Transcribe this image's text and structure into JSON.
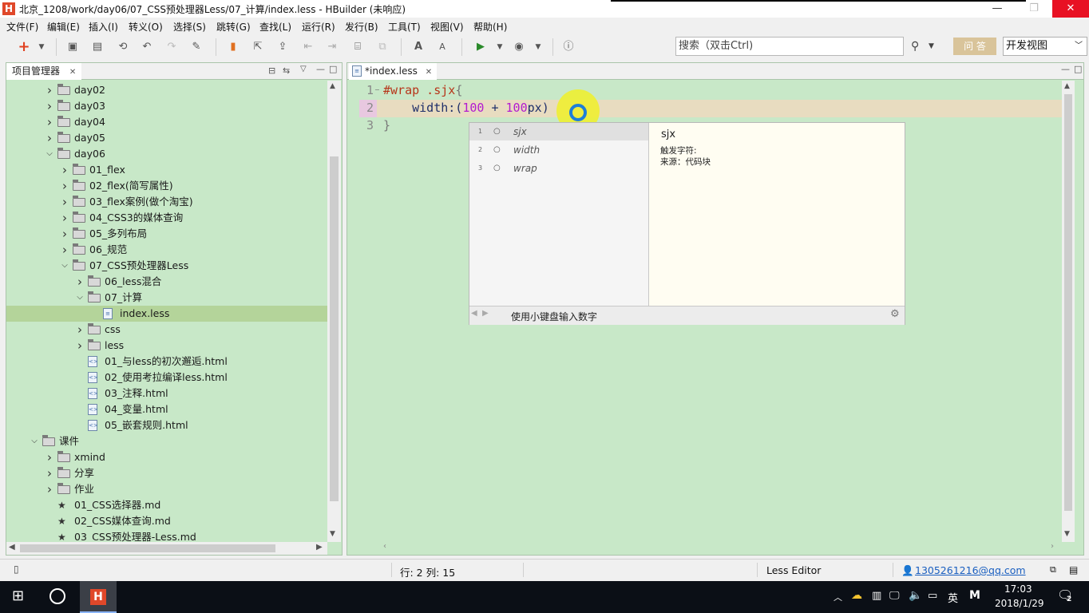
{
  "window": {
    "title": "北京_1208/work/day06/07_CSS预处理器Less/07_计算/index.less - HBuilder  (未响应)",
    "logo": "H",
    "minimize": "—",
    "maximize": "❐",
    "close": "✕"
  },
  "menu": [
    "文件(F)",
    "编辑(E)",
    "插入(I)",
    "转义(O)",
    "选择(S)",
    "跳转(G)",
    "查找(L)",
    "运行(R)",
    "发行(B)",
    "工具(T)",
    "视图(V)",
    "帮助(H)"
  ],
  "toolbar": {
    "search_placeholder": "搜索（双击Ctrl)",
    "ask_label": "问 答",
    "view_select": "开发视图"
  },
  "project_panel": {
    "tab_label": "项目管理器",
    "tree": [
      {
        "label": "day02",
        "type": "folder",
        "depth": 2,
        "state": "collapsed"
      },
      {
        "label": "day03",
        "type": "folder",
        "depth": 2,
        "state": "collapsed"
      },
      {
        "label": "day04",
        "type": "folder",
        "depth": 2,
        "state": "collapsed"
      },
      {
        "label": "day05",
        "type": "folder",
        "depth": 2,
        "state": "collapsed"
      },
      {
        "label": "day06",
        "type": "folder",
        "depth": 2,
        "state": "expanded"
      },
      {
        "label": "01_flex",
        "type": "folder",
        "depth": 3,
        "state": "collapsed"
      },
      {
        "label": "02_flex(简写属性)",
        "type": "folder",
        "depth": 3,
        "state": "collapsed"
      },
      {
        "label": "03_flex案例(做个淘宝)",
        "type": "folder",
        "depth": 3,
        "state": "collapsed"
      },
      {
        "label": "04_CSS3的媒体查询",
        "type": "folder",
        "depth": 3,
        "state": "collapsed"
      },
      {
        "label": "05_多列布局",
        "type": "folder",
        "depth": 3,
        "state": "collapsed"
      },
      {
        "label": "06_规范",
        "type": "folder",
        "depth": 3,
        "state": "collapsed"
      },
      {
        "label": "07_CSS预处理器Less",
        "type": "folder",
        "depth": 3,
        "state": "expanded"
      },
      {
        "label": "06_less混合",
        "type": "folder",
        "depth": 4,
        "state": "collapsed"
      },
      {
        "label": "07_计算",
        "type": "folder",
        "depth": 4,
        "state": "expanded"
      },
      {
        "label": "index.less",
        "type": "less",
        "depth": 5,
        "state": "selected"
      },
      {
        "label": "css",
        "type": "folder",
        "depth": 4,
        "state": "collapsed"
      },
      {
        "label": "less",
        "type": "folder",
        "depth": 4,
        "state": "collapsed"
      },
      {
        "label": "01_与less的初次邂逅.html",
        "type": "html",
        "depth": 4,
        "state": "leaf"
      },
      {
        "label": "02_使用考拉编译less.html",
        "type": "html",
        "depth": 4,
        "state": "leaf"
      },
      {
        "label": "03_注释.html",
        "type": "html",
        "depth": 4,
        "state": "leaf"
      },
      {
        "label": "04_变量.html",
        "type": "html",
        "depth": 4,
        "state": "leaf"
      },
      {
        "label": "05_嵌套规则.html",
        "type": "html",
        "depth": 4,
        "state": "leaf"
      },
      {
        "label": "课件",
        "type": "folder",
        "depth": 1,
        "state": "expanded"
      },
      {
        "label": "xmind",
        "type": "folder",
        "depth": 2,
        "state": "collapsed"
      },
      {
        "label": "分享",
        "type": "folder",
        "depth": 2,
        "state": "collapsed"
      },
      {
        "label": "作业",
        "type": "folder",
        "depth": 2,
        "state": "collapsed"
      },
      {
        "label": "01_CSS选择器.md",
        "type": "md",
        "depth": 2,
        "state": "leaf"
      },
      {
        "label": "02_CSS媒体查询.md",
        "type": "md",
        "depth": 2,
        "state": "leaf"
      },
      {
        "label": "03_CSS预处理器-Less.md",
        "type": "md",
        "depth": 2,
        "state": "leaf"
      }
    ]
  },
  "editor": {
    "tab_label": "*index.less",
    "lines": [
      "1",
      "2",
      "3"
    ],
    "code": {
      "l1_selector": "#wrap .sjx",
      "l1_brace": "{",
      "l2_prop": "width",
      "l2_colon": ":(",
      "l2_num1": "100",
      "l2_op": " + ",
      "l2_num2": "100",
      "l2_unit": "px",
      "l2_close": ")",
      "l3_brace": "}"
    }
  },
  "completion": {
    "items": [
      {
        "index": "1",
        "text": "sjx"
      },
      {
        "index": "2",
        "text": "width"
      },
      {
        "index": "3",
        "text": "wrap"
      }
    ],
    "detail_title": "sjx",
    "detail_trigger": "触发字符:",
    "detail_source": "来源：代码块",
    "footer_hint": "使用小键盘输入数字"
  },
  "statusbar": {
    "position": "行: 2 列: 15",
    "editor_type": "Less Editor",
    "user": "1305261216@qq.com"
  },
  "taskbar": {
    "time": "17:03",
    "date": "2018/1/29",
    "ime_lang": "英",
    "ime_mode": "M",
    "notifications": "2"
  },
  "colors": {
    "editor_bg": "#c8e8c8",
    "keyword": "#b7351a",
    "number": "#b31ad0",
    "close_btn": "#e81123"
  }
}
